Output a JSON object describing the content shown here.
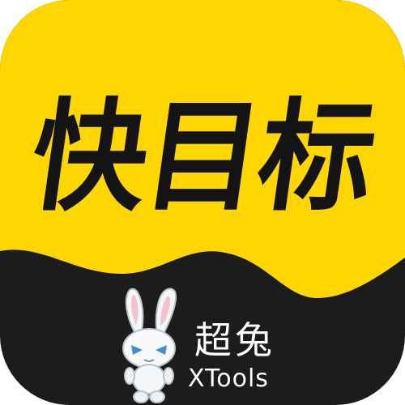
{
  "app": {
    "title": "快目标"
  },
  "brand": {
    "name_cn": "超兔",
    "name_en": "XTools",
    "mascot_icon": "rabbit-icon"
  },
  "colors": {
    "accent": "#FFD600",
    "dark": "#1C1C1C",
    "text_dark": "#141414",
    "text_light": "#FFFFFF",
    "mascot_blue": "#3A8FD8"
  }
}
